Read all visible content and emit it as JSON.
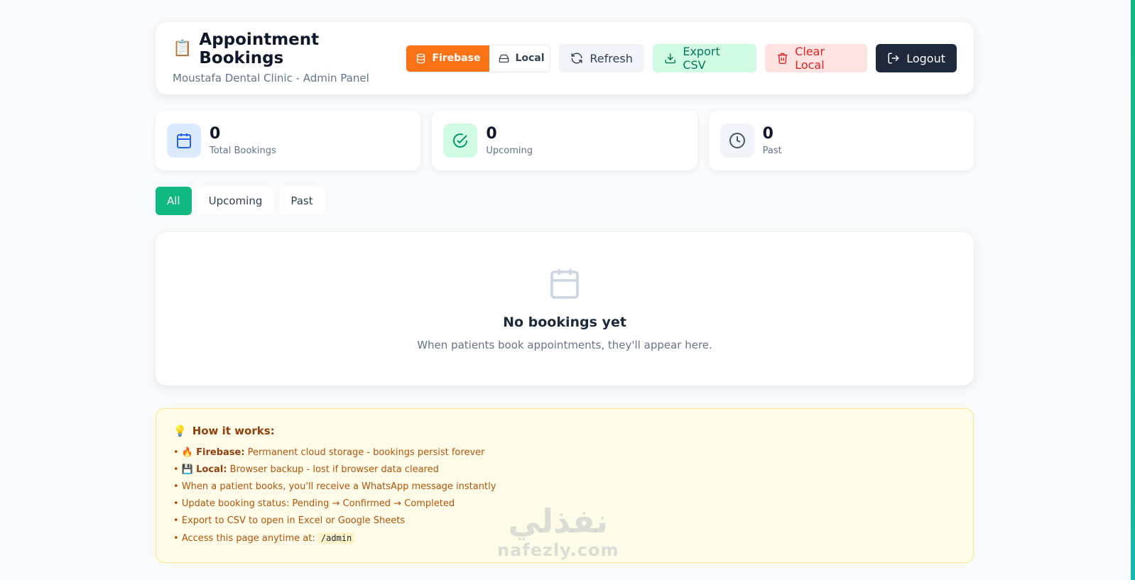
{
  "header": {
    "icon": "📋",
    "title": "Appointment Bookings",
    "subtitle": "Moustafa Dental Clinic - Admin Panel",
    "storage": {
      "firebase_label": "Firebase",
      "local_label": "Local",
      "active": "Firebase"
    },
    "buttons": {
      "refresh": "Refresh",
      "export": "Export CSV",
      "clear": "Clear Local",
      "logout": "Logout"
    }
  },
  "stats": [
    {
      "value": "0",
      "label": "Total Bookings",
      "icon": "calendar-icon"
    },
    {
      "value": "0",
      "label": "Upcoming",
      "icon": "check-circle-icon"
    },
    {
      "value": "0",
      "label": "Past",
      "icon": "clock-icon"
    }
  ],
  "filters": {
    "all": "All",
    "upcoming": "Upcoming",
    "past": "Past",
    "active": "All"
  },
  "empty": {
    "title": "No bookings yet",
    "text": "When patients book appointments, they'll appear here."
  },
  "info": {
    "icon": "💡",
    "title": "How it works:",
    "items": [
      {
        "emoji": "🔥",
        "bold": "Firebase:",
        "text": " Permanent cloud storage - bookings persist forever"
      },
      {
        "emoji": "💾",
        "bold": "Local:",
        "text": " Browser backup - lost if browser data cleared"
      },
      {
        "text": "When a patient books, you'll receive a WhatsApp message instantly"
      },
      {
        "text": "Update booking status: Pending → Confirmed → Completed"
      },
      {
        "text": "Export to CSV to open in Excel or Google Sheets"
      },
      {
        "text": "Access this page anytime at: ",
        "code": "/admin"
      }
    ]
  },
  "watermark": {
    "arabic": "نفذلي",
    "latin": "nafezly.com"
  },
  "colors": {
    "firebase": "#f97316",
    "filter_active": "#10b981",
    "logout": "#1e293b",
    "export": "#d1fae5",
    "clear": "#fee2e2"
  }
}
